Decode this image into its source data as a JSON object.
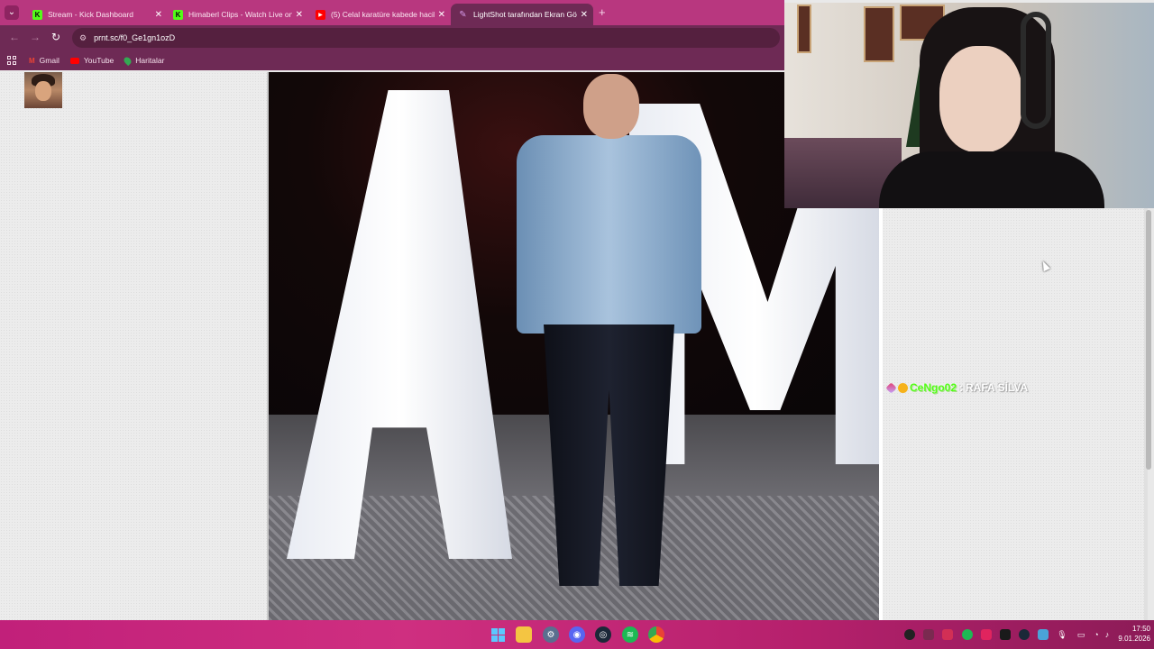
{
  "browser": {
    "tabs": [
      {
        "label": "Stream - Kick Dashboard",
        "favicon": "kick-icon",
        "active": false
      },
      {
        "label": "Himaberl Clips - Watch Live on",
        "favicon": "kick-icon",
        "active": false
      },
      {
        "label": "(5) Celal karatüre kabede hacik",
        "favicon": "youtube-icon",
        "active": false
      },
      {
        "label": "LightShot tarafından Ekran Gör",
        "favicon": "lightshot-icon",
        "active": true
      }
    ],
    "new_tab_symbol": "+",
    "url": "prnt.sc/f0_Ge1gn1ozD",
    "bookmarks": [
      {
        "label": "Gmail",
        "icon": "gmail-icon"
      },
      {
        "label": "YouTube",
        "icon": "youtube-icon"
      },
      {
        "label": "Haritalar",
        "icon": "maps-icon"
      }
    ]
  },
  "chat": {
    "username": "CeNgo02",
    "separator": ":",
    "message": "RAFA SİLVA",
    "badges": [
      "sub-badge-icon",
      "emoji-badge-icon"
    ],
    "colors": {
      "username": "#53fc18",
      "message": "#ffffff"
    }
  },
  "taskbar": {
    "apps": [
      "windows-start-icon",
      "file-explorer-icon",
      "settings-icon",
      "discord-icon",
      "steam-icon",
      "spotify-icon",
      "chrome-icon"
    ],
    "tray": [
      "obs-icon",
      "tray-icon-2",
      "tray-icon-3",
      "spotify-tray-icon",
      "tray-icon-5",
      "tray-icon-6",
      "steam-tray-icon",
      "tray-icon-8",
      "microphone-icon",
      "display-icon",
      "wifi-icon",
      "volume-icon"
    ],
    "time": "17:50",
    "date": "9.01.2026"
  },
  "colors": {
    "tab_bar": "#b8377f",
    "toolbar": "#6e2a55",
    "accent_green": "#53fc18"
  }
}
